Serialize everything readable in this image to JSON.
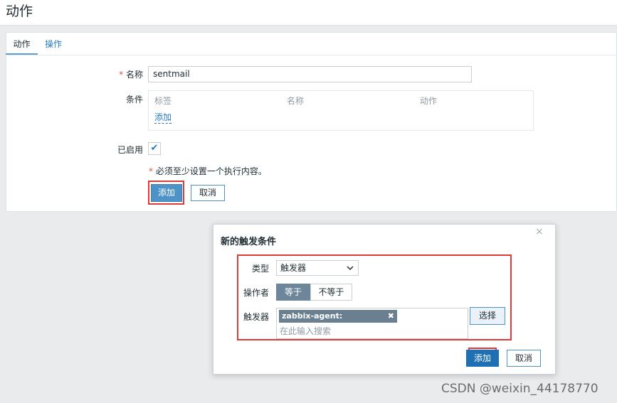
{
  "page": {
    "title": "动作"
  },
  "tabs": [
    {
      "label": "动作",
      "active": true
    },
    {
      "label": "操作",
      "active": false
    }
  ],
  "form": {
    "required_marker": "*",
    "name_label": "名称",
    "name_value": "sentmail",
    "conditions_label": "条件",
    "conditions_columns": [
      "标签",
      "名称",
      "动作"
    ],
    "conditions_add_link": "添加",
    "enabled_label": "已启用",
    "enabled_checked": true,
    "enabled_check_glyph": "✔",
    "validation_note": "必须至少设置一个执行内容。",
    "add_button": "添加",
    "cancel_button": "取消"
  },
  "dialog": {
    "title": "新的触发条件",
    "close_glyph": "×",
    "type_label": "类型",
    "type_value": "触发器",
    "operator_label": "操作者",
    "operator_options": [
      "等于",
      "不等于"
    ],
    "operator_selected": "等于",
    "trigger_label": "触发器",
    "trigger_chip": "zabbix-agent: nginx_status",
    "chip_remove_glyph": "✖",
    "trigger_placeholder": "在此输入搜索",
    "select_button": "选择",
    "add_button": "添加",
    "cancel_button": "取消"
  },
  "watermark": "CSDN @weixin_44178770",
  "colors": {
    "accent": "#4d93c8",
    "highlight": "#e03b3b",
    "link": "#2a7bbd"
  }
}
